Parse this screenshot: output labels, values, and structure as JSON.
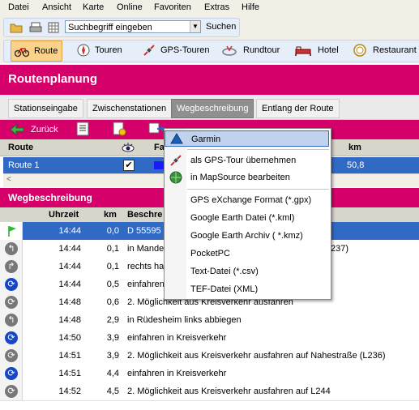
{
  "menubar": {
    "items": [
      "Datei",
      "Ansicht",
      "Karte",
      "Online",
      "Favoriten",
      "Extras",
      "Hilfe"
    ]
  },
  "search": {
    "value": "Suchbegriff eingeben",
    "button": "Suchen"
  },
  "nav": {
    "route": "Route",
    "touren": "Touren",
    "gps_touren": "GPS-Touren",
    "rundtour": "Rundtour",
    "hotel": "Hotel",
    "restaurant": "Restaurant"
  },
  "panel": {
    "title": "Routenplanung"
  },
  "tabs": [
    "Stationseingabe",
    "Zwischenstationen",
    "Wegbeschreibung",
    "Entlang der Route"
  ],
  "toolbar": {
    "back": "Zurück"
  },
  "route_grid": {
    "headers": {
      "route": "Route",
      "fa": "Fa",
      "km": "km"
    },
    "row": {
      "name": "Route 1",
      "km": "50,8"
    }
  },
  "directions": {
    "title": "Wegbeschreibung",
    "headers": {
      "uhrzeit": "Uhrzeit",
      "km": "km",
      "beschreibung": "Beschre"
    },
    "rows": [
      {
        "time": "14:44",
        "km": "0,0",
        "text": "D 55595 I",
        "icon": "start-flag-icon"
      },
      {
        "time": "14:44",
        "km": "0,1",
        "text": "in Mandel",
        "text2": "237)",
        "icon": "turn-left-icon"
      },
      {
        "time": "14:44",
        "km": "0,1",
        "text": "rechts ha",
        "icon": "turn-right-icon"
      },
      {
        "time": "14:44",
        "km": "0,5",
        "text": "einfahren",
        "icon": "roundabout-icon"
      },
      {
        "time": "14:48",
        "km": "0,6",
        "text": "2. Möglichkeit aus Kreisverkehr ausfahren",
        "icon": "roundabout-exit-icon"
      },
      {
        "time": "14:48",
        "km": "2,9",
        "text": "in Rüdesheim links abbiegen",
        "icon": "turn-left-icon"
      },
      {
        "time": "14:50",
        "km": "3,9",
        "text": "einfahren in Kreisverkehr",
        "icon": "roundabout-icon"
      },
      {
        "time": "14:51",
        "km": "3,9",
        "text": "2. Möglichkeit aus Kreisverkehr ausfahren auf Nahestraße (L236)",
        "icon": "roundabout-exit-icon"
      },
      {
        "time": "14:51",
        "km": "4,4",
        "text": "einfahren in Kreisverkehr",
        "icon": "roundabout-icon"
      },
      {
        "time": "14:52",
        "km": "4,5",
        "text": "2. Möglichkeit aus Kreisverkehr ausfahren auf L244",
        "icon": "roundabout-exit-icon"
      }
    ]
  },
  "context_menu": {
    "items": [
      {
        "label": "Garmin",
        "icon": "garmin-icon"
      },
      {
        "label": "als GPS-Tour übernehmen",
        "icon": "gps-tour-icon"
      },
      {
        "label": "in MapSource bearbeiten",
        "icon": "mapsource-globe-icon"
      },
      {
        "label": "GPS eXchange Format (*.gpx)"
      },
      {
        "label": "Google Earth Datei (*.kml)"
      },
      {
        "label": "Google Earth Archiv ( *.kmz)"
      },
      {
        "label": "PocketPC"
      },
      {
        "label": "Text-Datei (*.csv)"
      },
      {
        "label": "TEF-Datei (XML)"
      }
    ]
  },
  "colors": {
    "magenta": "#d6006b",
    "selection": "#316ac5",
    "highlight": "#c1d2ee"
  }
}
